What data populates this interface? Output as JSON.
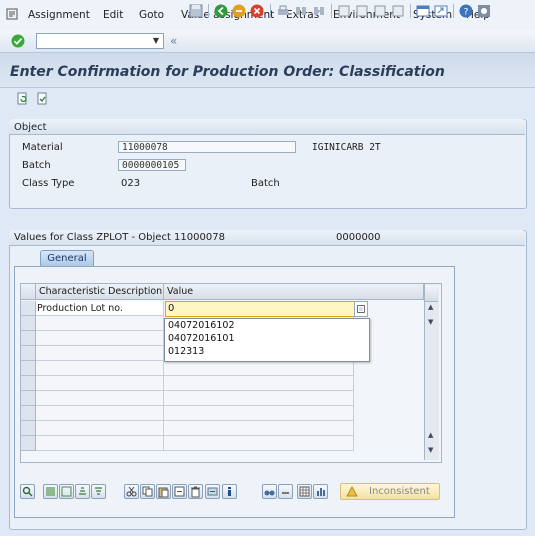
{
  "menubar": {
    "items": [
      "Assignment",
      "Edit",
      "Goto",
      "Value assignment",
      "Extras",
      "Environment",
      "System",
      "Help"
    ]
  },
  "toolbar": {
    "command_field_value": "",
    "back_glyph": "«"
  },
  "page": {
    "title": "Enter Confirmation for Production Order: Classification"
  },
  "object": {
    "section_title": "Object",
    "material_label": "Material",
    "material_value": "11000078",
    "material_desc": "IGINICARB 2T",
    "batch_label": "Batch",
    "batch_value": "0000000105",
    "class_type_label": "Class Type",
    "class_type_value": "023",
    "class_type_desc": "Batch"
  },
  "values_section": {
    "title": "Values for Class ZPLOT - Object 11000078",
    "right_value": "0000000",
    "tab_label": "General"
  },
  "grid": {
    "headers": [
      "Characteristic Description",
      "Value"
    ],
    "rows": [
      {
        "description": "Production Lot no.",
        "value": "0"
      }
    ]
  },
  "dropdown": {
    "options": [
      "04072016102",
      "04072016101",
      "012313"
    ]
  },
  "bottom_toolbar": {
    "inconsistent_label": "Inconsistent"
  },
  "colors": {
    "accent": "#2a3d59",
    "input_highlight": "#fff7c2",
    "background": "#dfe9f5"
  }
}
